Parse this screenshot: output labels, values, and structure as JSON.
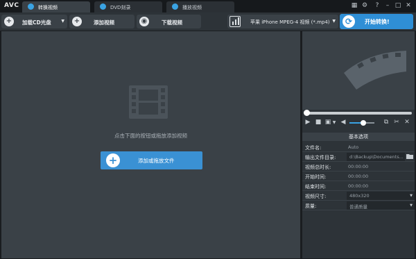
{
  "app": {
    "logo": "AVC"
  },
  "tabs": [
    {
      "label": "转换视频",
      "icon": "refresh-icon",
      "active": true
    },
    {
      "label": "DVD刻录",
      "icon": "disc-icon",
      "active": false
    },
    {
      "label": "播放视频",
      "icon": "play-icon",
      "active": false
    }
  ],
  "window_controls": [
    "grid-icon",
    "gear-icon",
    "help-icon",
    "minimize-icon",
    "maximize-icon",
    "close-icon"
  ],
  "toolbar": {
    "add_cd": "加载CD光盘",
    "add_video": "添加视频",
    "download_video": "下载视频",
    "profile": "苹果 iPhone MPEG-4 视频 (*.mp4)",
    "start": "开始转换!"
  },
  "main": {
    "hint": "点击下面的按钮或拖放添加视频",
    "add_button": "添加或拖放文件"
  },
  "panel": {
    "title": "基本选项",
    "props": [
      {
        "key": "文件名:",
        "value": "Auto"
      },
      {
        "key": "输出文件目录:",
        "value": "d:\\Backup\\Documents..."
      },
      {
        "key": "视频总时长:",
        "value": "00:00:00"
      },
      {
        "key": "开始时间:",
        "value": "00:00:00"
      },
      {
        "key": "结束时间:",
        "value": "00:00:00"
      },
      {
        "key": "视频尺寸:",
        "value": "480x320"
      },
      {
        "key": "质量:",
        "value": "普通质量"
      }
    ]
  },
  "playback": {
    "volume": 0.55,
    "position": 0.0
  },
  "colors": {
    "accent": "#2f8fd6",
    "background": "#3a4147",
    "panel": "#2d3338"
  }
}
